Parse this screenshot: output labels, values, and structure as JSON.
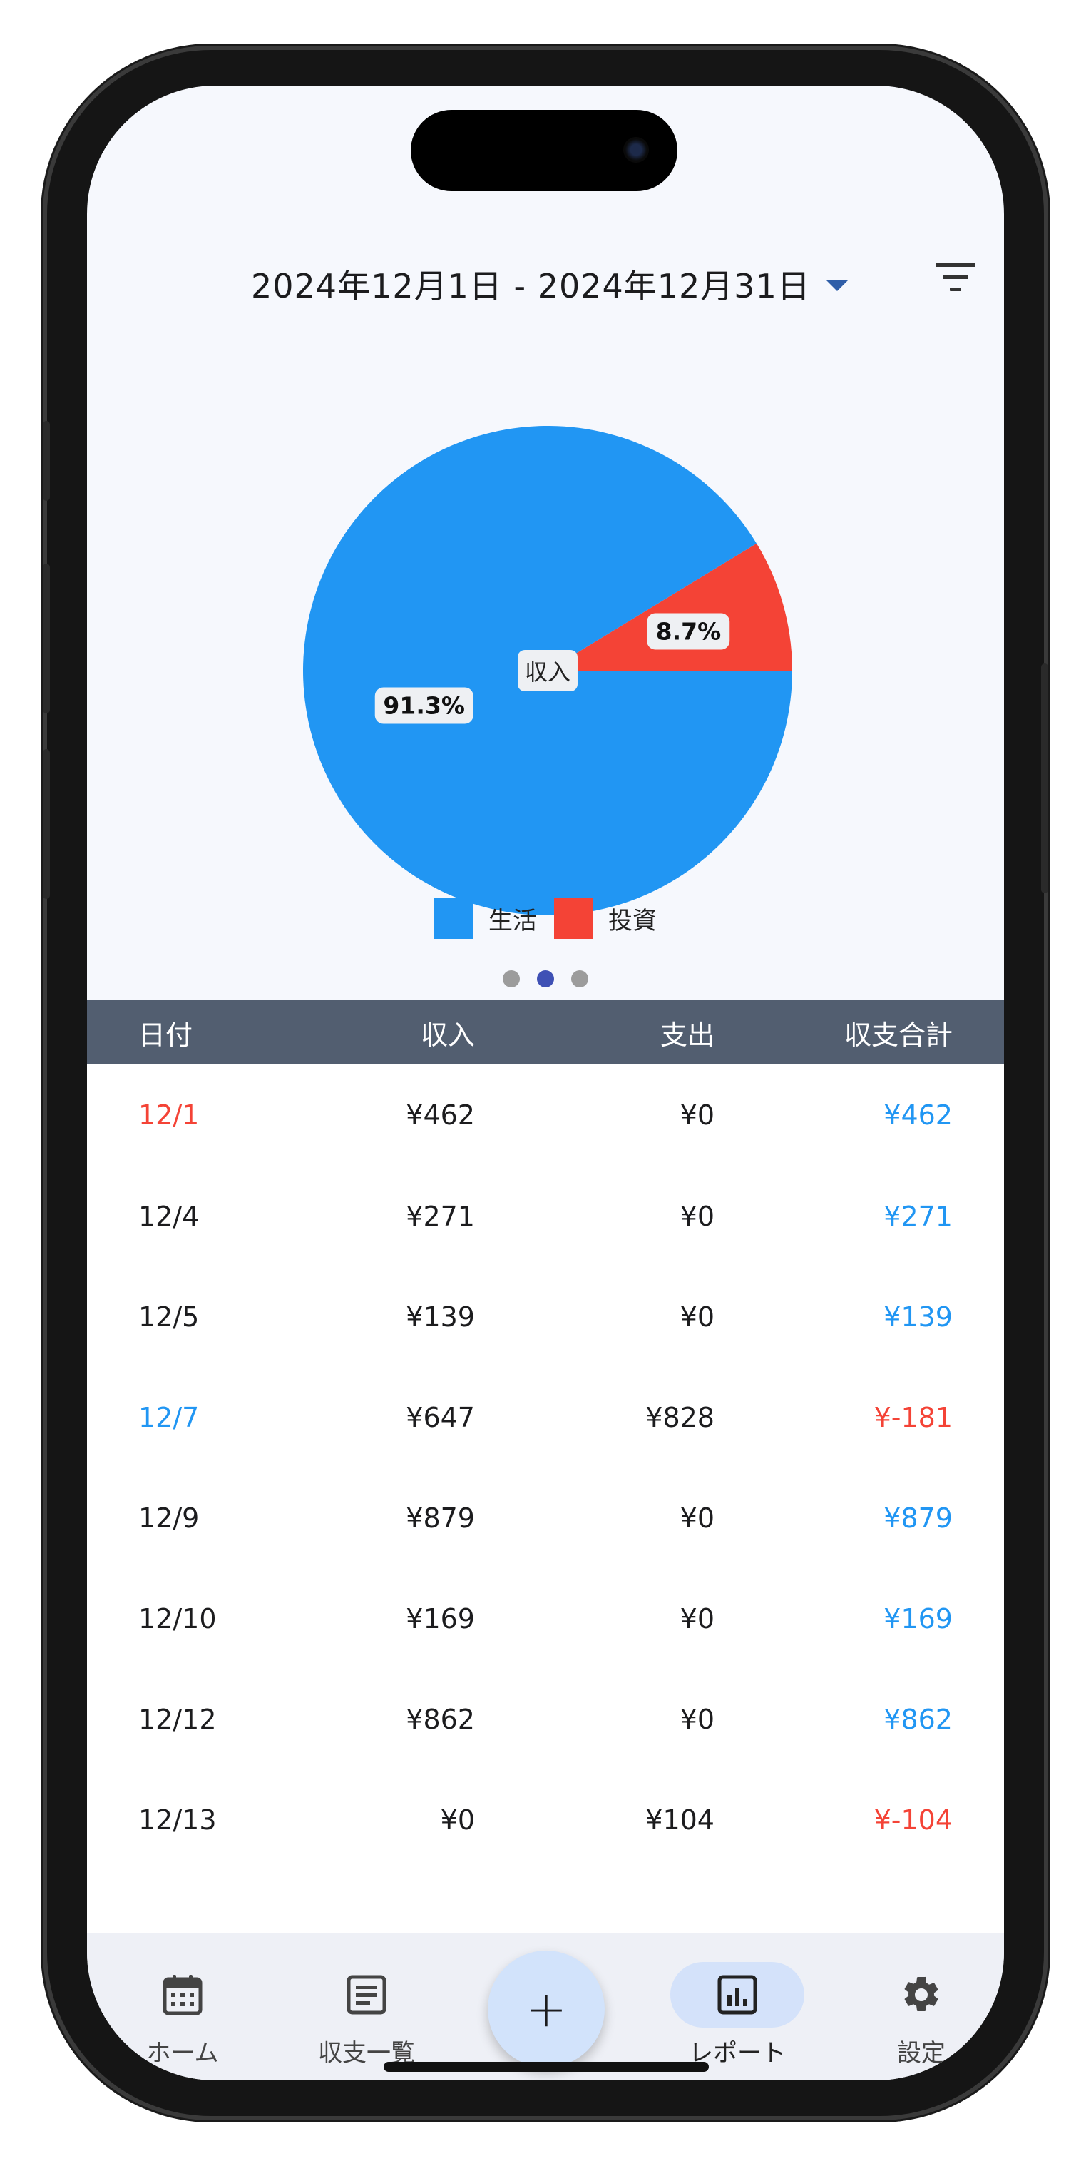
{
  "header": {
    "date_range": "2024年12月1日 - 2024年12月31日"
  },
  "chart_data": {
    "type": "pie",
    "center_label": "収入",
    "slices": [
      {
        "name": "生活",
        "value": 91.3,
        "label": "91.3%",
        "color": "#2196f3"
      },
      {
        "name": "投資",
        "value": 8.7,
        "label": "8.7%",
        "color": "#f44336"
      }
    ],
    "legend": [
      "生活",
      "投資"
    ],
    "legend_placement": "bottom"
  },
  "pager": {
    "count": 3,
    "active": 2
  },
  "table": {
    "headers": {
      "date": "日付",
      "income": "収入",
      "expense": "支出",
      "total": "収支合計"
    },
    "rows": [
      {
        "date": "12/1",
        "income": "¥462",
        "expense": "¥0",
        "total": "¥462",
        "date_color": "#f44336",
        "total_color": "#2196f3"
      },
      {
        "date": "12/4",
        "income": "¥271",
        "expense": "¥0",
        "total": "¥271",
        "date_color": "#1c1c1e",
        "total_color": "#2196f3"
      },
      {
        "date": "12/5",
        "income": "¥139",
        "expense": "¥0",
        "total": "¥139",
        "date_color": "#1c1c1e",
        "total_color": "#2196f3"
      },
      {
        "date": "12/7",
        "income": "¥647",
        "expense": "¥828",
        "total": "¥-181",
        "date_color": "#2196f3",
        "total_color": "#f44336"
      },
      {
        "date": "12/9",
        "income": "¥879",
        "expense": "¥0",
        "total": "¥879",
        "date_color": "#1c1c1e",
        "total_color": "#2196f3"
      },
      {
        "date": "12/10",
        "income": "¥169",
        "expense": "¥0",
        "total": "¥169",
        "date_color": "#1c1c1e",
        "total_color": "#2196f3"
      },
      {
        "date": "12/12",
        "income": "¥862",
        "expense": "¥0",
        "total": "¥862",
        "date_color": "#1c1c1e",
        "total_color": "#2196f3"
      },
      {
        "date": "12/13",
        "income": "¥0",
        "expense": "¥104",
        "total": "¥-104",
        "date_color": "#1c1c1e",
        "total_color": "#f44336"
      }
    ]
  },
  "nav": {
    "items": [
      {
        "label": "ホーム",
        "icon": "calendar-icon"
      },
      {
        "label": "収支一覧",
        "icon": "list-document-icon"
      },
      {
        "label": "レポート",
        "icon": "bar-chart-icon",
        "active": true
      },
      {
        "label": "設定",
        "icon": "gear-icon"
      }
    ],
    "fab_label": "+"
  },
  "colors": {
    "accent": "#2196f3",
    "negative": "#f44336",
    "table_header_bg": "#525e70",
    "nav_active_bg": "#d4e2fa"
  }
}
